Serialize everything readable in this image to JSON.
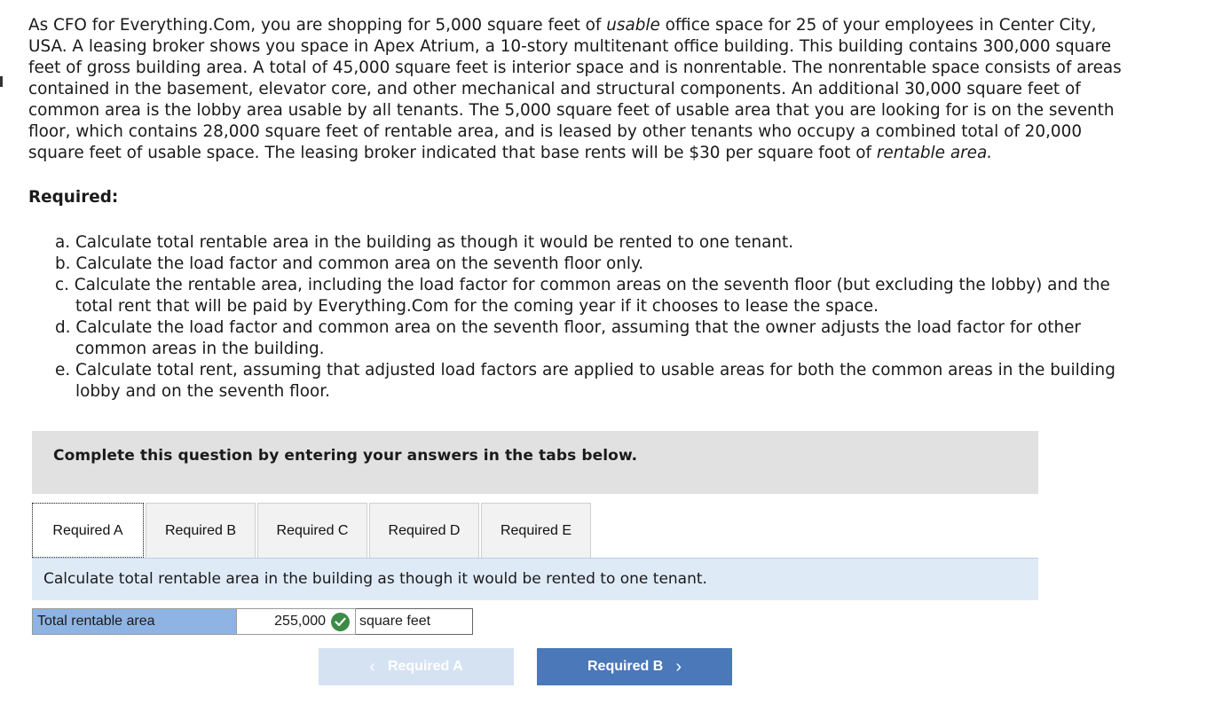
{
  "problem": {
    "p1": "As CFO for Everything.Com, you are shopping for 5,000 square feet of ",
    "p1_em": "usable",
    "p2": " office space for 25 of your employees in Center City, USA. A leasing broker shows you space in Apex Atrium, a 10-story multitenant office building. This building contains 300,000 square feet of gross building area. A total of 45,000 square feet is interior space and is nonrentable. The nonrentable space consists of areas contained in the basement, elevator core, and other mechanical and structural components. An additional 30,000 square feet of common area is the lobby area usable by all tenants. The 5,000 square feet of usable area that you are looking for is on the seventh floor, which contains 28,000 square feet of rentable area, and is leased by other tenants who occupy a combined total of 20,000 square feet of usable space. The leasing broker indicated that base rents will be $30 per square foot of ",
    "p2_em": "rentable area.",
    "p3": ""
  },
  "required_heading": "Required:",
  "requirements": [
    "a. Calculate total rentable area in the building as though it would be rented to one tenant.",
    "b. Calculate the load factor and common area on the seventh floor only.",
    "c. Calculate the rentable area, including the load factor for common areas on the seventh floor (but excluding the lobby) and the total rent that will be paid by Everything.Com for the coming year if it chooses to lease the space.",
    "d. Calculate the load factor and common area on the seventh floor, assuming that the owner adjusts the load factor for other common areas in the building.",
    "e. Calculate total rent, assuming that adjusted load factors are applied to usable areas for both the common areas in the building lobby and on the seventh floor."
  ],
  "instructions": "Complete this question by entering your answers in the tabs below.",
  "tabs": [
    "Required A",
    "Required B",
    "Required C",
    "Required D",
    "Required E"
  ],
  "active_tab": "Required A",
  "prompt": "Calculate total rentable area in the building as though it would be rented to one tenant.",
  "answer": {
    "label": "Total rentable area",
    "value": "255,000",
    "status_icon": "check-circle-icon",
    "unit": "square feet"
  },
  "nav": {
    "prev_label": "Required A",
    "next_label": "Required B"
  },
  "colors": {
    "instructions_bg": "#e1e1e1",
    "prompt_bg": "#dfeaf7",
    "label_cell_bg": "#8fb4e3",
    "correct_check": "#3d8b47",
    "next_button": "#4a78b8",
    "prev_button_disabled": "#d5e2f2"
  }
}
